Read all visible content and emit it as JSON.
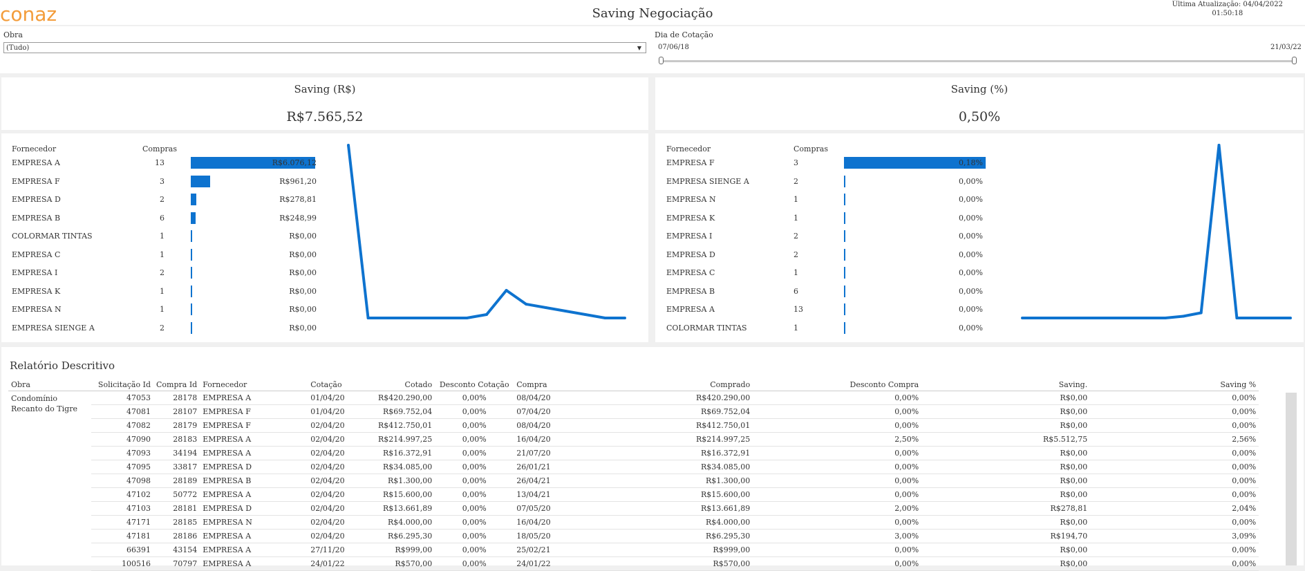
{
  "header": {
    "logo_text": "conaz",
    "title": "Saving Negociação",
    "update_line1": "Última Atualização: 04/04/2022",
    "update_line2": "01:50:18"
  },
  "filters": {
    "obra_label": "Obra",
    "obra_value": "(Tudo)",
    "dia_label": "Dia de Cotação",
    "date_start": "07/06/18",
    "date_end": "21/03/22"
  },
  "kpis": {
    "saving_rs_title": "Saving (R$)",
    "saving_rs_value": "R$7.565,52",
    "saving_pct_title": "Saving (%)",
    "saving_pct_value": "0,50%"
  },
  "left_chart": {
    "col_fornecedor": "Fornecedor",
    "col_compras": "Compras",
    "rows": [
      {
        "name": "EMPRESA A",
        "compras": "13",
        "label": "R$6.076,12",
        "value": 6076.12
      },
      {
        "name": "EMPRESA F",
        "compras": "3",
        "label": "R$961,20",
        "value": 961.2
      },
      {
        "name": "EMPRESA D",
        "compras": "2",
        "label": "R$278,81",
        "value": 278.81
      },
      {
        "name": "EMPRESA B",
        "compras": "6",
        "label": "R$248,99",
        "value": 248.99
      },
      {
        "name": "COLORMAR TINTAS",
        "compras": "1",
        "label": "R$0,00",
        "value": 0
      },
      {
        "name": "EMPRESA C",
        "compras": "1",
        "label": "R$0,00",
        "value": 0
      },
      {
        "name": "EMPRESA I",
        "compras": "2",
        "label": "R$0,00",
        "value": 0
      },
      {
        "name": "EMPRESA K",
        "compras": "1",
        "label": "R$0,00",
        "value": 0
      },
      {
        "name": "EMPRESA N",
        "compras": "1",
        "label": "R$0,00",
        "value": 0
      },
      {
        "name": "EMPRESA SIENGE A",
        "compras": "2",
        "label": "R$0,00",
        "value": 0
      }
    ],
    "bar_max": 6076.12
  },
  "right_chart": {
    "col_fornecedor": "Fornecedor",
    "col_compras": "Compras",
    "rows": [
      {
        "name": "EMPRESA F",
        "compras": "3",
        "label": "0,18%",
        "value": 0.18
      },
      {
        "name": "EMPRESA SIENGE A",
        "compras": "2",
        "label": "0,00%",
        "value": 0
      },
      {
        "name": "EMPRESA N",
        "compras": "1",
        "label": "0,00%",
        "value": 0
      },
      {
        "name": "EMPRESA K",
        "compras": "1",
        "label": "0,00%",
        "value": 0
      },
      {
        "name": "EMPRESA I",
        "compras": "2",
        "label": "0,00%",
        "value": 0
      },
      {
        "name": "EMPRESA D",
        "compras": "2",
        "label": "0,00%",
        "value": 0
      },
      {
        "name": "EMPRESA C",
        "compras": "1",
        "label": "0,00%",
        "value": 0
      },
      {
        "name": "EMPRESA B",
        "compras": "6",
        "label": "0,00%",
        "value": 0
      },
      {
        "name": "EMPRESA A",
        "compras": "13",
        "label": "0,00%",
        "value": 0
      },
      {
        "name": "COLORMAR TINTAS",
        "compras": "1",
        "label": "0,00%",
        "value": 0
      }
    ],
    "bar_max": 0.18
  },
  "chart_data": [
    {
      "type": "line",
      "series": [
        {
          "values": [
            1.0,
            0.0,
            0.0,
            0.0,
            0.0,
            0.0,
            0.0,
            0.02,
            0.16,
            0.08,
            0.06,
            0.04,
            0.02,
            0.0,
            0.0
          ]
        }
      ],
      "ylim": [
        0,
        1
      ],
      "grid": false
    },
    {
      "type": "line",
      "series": [
        {
          "values": [
            0.0,
            0.0,
            0.0,
            0.0,
            0.0,
            0.0,
            0.0,
            0.0,
            0.0,
            0.01,
            0.03,
            1.0,
            0.0,
            0.0,
            0.0,
            0.0
          ]
        }
      ],
      "ylim": [
        0,
        1
      ],
      "grid": false
    }
  ],
  "report": {
    "title": "Relatório Descritivo",
    "obra_name": "Condomínio Recanto do Tigre",
    "columns": [
      "Obra",
      "Solicitação Id",
      "Compra Id",
      "Fornecedor",
      "Cotação",
      "Cotado",
      "Desconto Cotação",
      "Compra",
      "Comprado",
      "Desconto Compra",
      "Saving.",
      "Saving %"
    ],
    "rows": [
      [
        "47053",
        "28178",
        "EMPRESA A",
        "01/04/20",
        "R$420.290,00",
        "0,00%",
        "08/04/20",
        "R$420.290,00",
        "0,00%",
        "R$0,00",
        "0,00%"
      ],
      [
        "47081",
        "28107",
        "EMPRESA F",
        "01/04/20",
        "R$69.752,04",
        "0,00%",
        "07/04/20",
        "R$69.752,04",
        "0,00%",
        "R$0,00",
        "0,00%"
      ],
      [
        "47082",
        "28179",
        "EMPRESA F",
        "02/04/20",
        "R$412.750,01",
        "0,00%",
        "08/04/20",
        "R$412.750,01",
        "0,00%",
        "R$0,00",
        "0,00%"
      ],
      [
        "47090",
        "28183",
        "EMPRESA A",
        "02/04/20",
        "R$214.997,25",
        "0,00%",
        "16/04/20",
        "R$214.997,25",
        "2,50%",
        "R$5.512,75",
        "2,56%"
      ],
      [
        "47093",
        "34194",
        "EMPRESA A",
        "02/04/20",
        "R$16.372,91",
        "0,00%",
        "21/07/20",
        "R$16.372,91",
        "0,00%",
        "R$0,00",
        "0,00%"
      ],
      [
        "47095",
        "33817",
        "EMPRESA D",
        "02/04/20",
        "R$34.085,00",
        "0,00%",
        "26/01/21",
        "R$34.085,00",
        "0,00%",
        "R$0,00",
        "0,00%"
      ],
      [
        "47098",
        "28189",
        "EMPRESA B",
        "02/04/20",
        "R$1.300,00",
        "0,00%",
        "26/04/21",
        "R$1.300,00",
        "0,00%",
        "R$0,00",
        "0,00%"
      ],
      [
        "47102",
        "50772",
        "EMPRESA A",
        "02/04/20",
        "R$15.600,00",
        "0,00%",
        "13/04/21",
        "R$15.600,00",
        "0,00%",
        "R$0,00",
        "0,00%"
      ],
      [
        "47103",
        "28181",
        "EMPRESA D",
        "02/04/20",
        "R$13.661,89",
        "0,00%",
        "07/05/20",
        "R$13.661,89",
        "2,00%",
        "R$278,81",
        "2,04%"
      ],
      [
        "47171",
        "28185",
        "EMPRESA N",
        "02/04/20",
        "R$4.000,00",
        "0,00%",
        "16/04/20",
        "R$4.000,00",
        "0,00%",
        "R$0,00",
        "0,00%"
      ],
      [
        "47181",
        "28186",
        "EMPRESA A",
        "02/04/20",
        "R$6.295,30",
        "0,00%",
        "18/05/20",
        "R$6.295,30",
        "3,00%",
        "R$194,70",
        "3,09%"
      ],
      [
        "66391",
        "43154",
        "EMPRESA A",
        "27/11/20",
        "R$999,00",
        "0,00%",
        "25/02/21",
        "R$999,00",
        "0,00%",
        "R$0,00",
        "0,00%"
      ],
      [
        "100516",
        "70797",
        "EMPRESA A",
        "24/01/22",
        "R$570,00",
        "0,00%",
        "24/01/22",
        "R$570,00",
        "0,00%",
        "R$0,00",
        "0,00%"
      ]
    ]
  },
  "colors": {
    "accent": "#0e73cf",
    "logo": "#f39c3a"
  },
  "icons": {
    "dropdown": "caret-down-icon",
    "logo": "conaz-logo-icon"
  }
}
